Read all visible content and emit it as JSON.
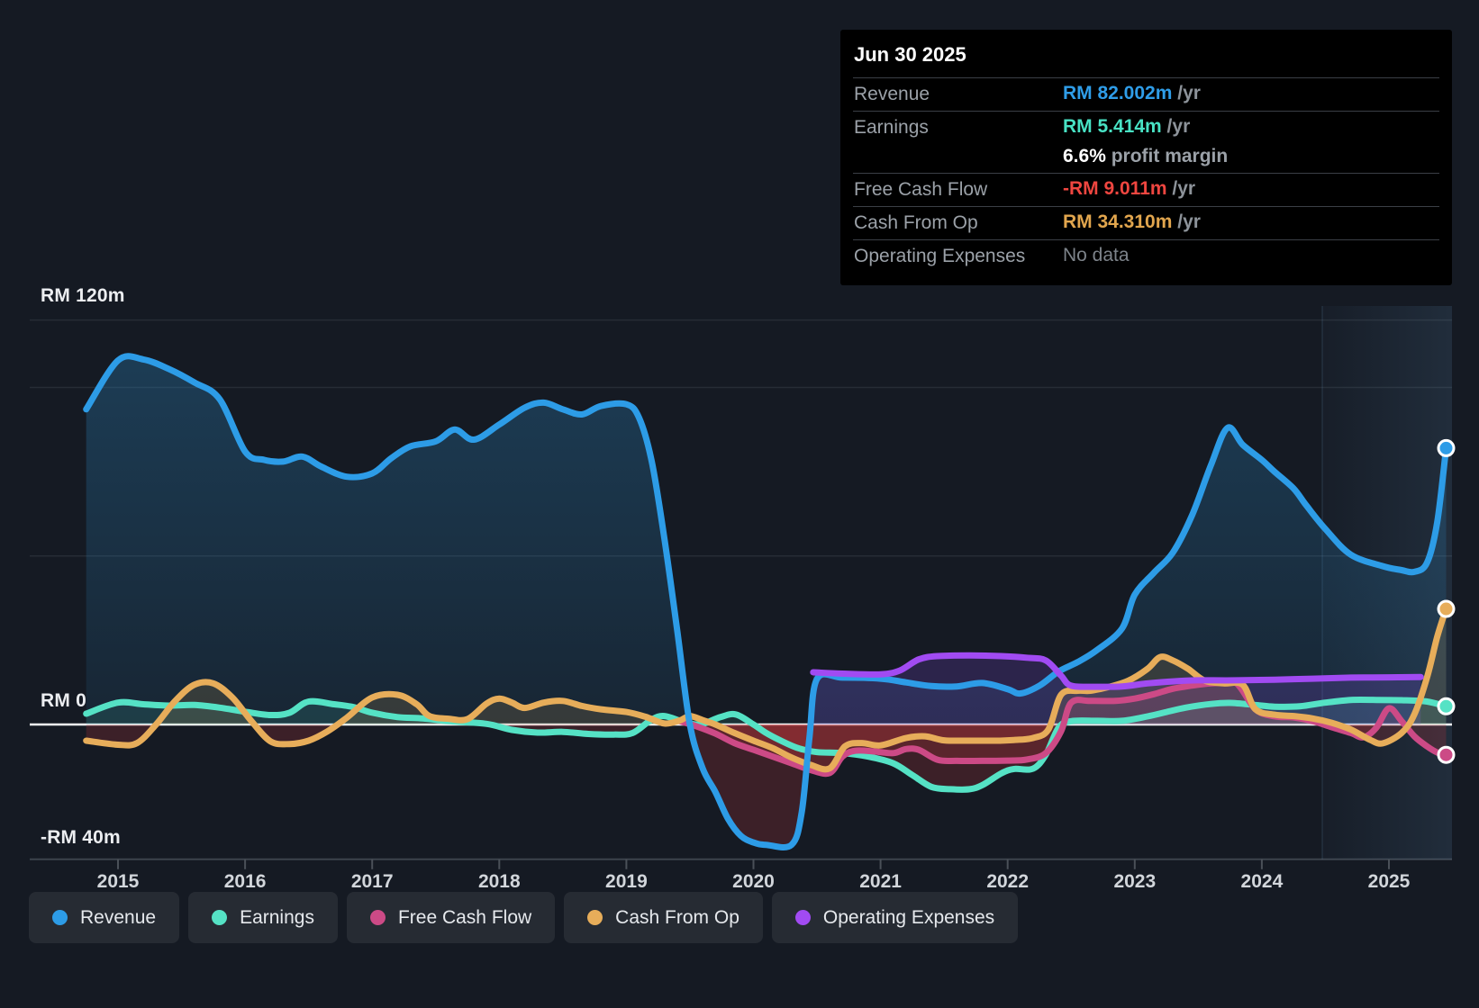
{
  "tooltip": {
    "date": "Jun 30 2025",
    "rows": [
      {
        "label": "Revenue",
        "value": "RM 82.002m",
        "suffix": " /yr",
        "color": "#2f9de8"
      },
      {
        "label": "Earnings",
        "value": "RM 5.414m",
        "suffix": " /yr",
        "color": "#48e2c4",
        "extra_value": "6.6%",
        "extra_text": " profit margin"
      },
      {
        "label": "Free Cash Flow",
        "value": "-RM 9.011m",
        "suffix": " /yr",
        "color": "#ef4640"
      },
      {
        "label": "Cash From Op",
        "value": "RM 34.310m",
        "suffix": " /yr",
        "color": "#e2a64e"
      },
      {
        "label": "Operating Expenses",
        "value": "No data",
        "suffix": "",
        "color": "#7d838a"
      }
    ]
  },
  "y_axis": {
    "labels": [
      {
        "text": "RM 120m",
        "value": 120
      },
      {
        "text": "RM 0",
        "value": 0
      },
      {
        "text": "-RM 40m",
        "value": -40
      }
    ]
  },
  "x_axis": {
    "years": [
      "2015",
      "2016",
      "2017",
      "2018",
      "2019",
      "2020",
      "2021",
      "2022",
      "2023",
      "2024",
      "2025"
    ]
  },
  "legend": [
    {
      "label": "Revenue",
      "color": "#2d9ce7"
    },
    {
      "label": "Earnings",
      "color": "#55e2c5"
    },
    {
      "label": "Free Cash Flow",
      "color": "#cc4a86"
    },
    {
      "label": "Cash From Op",
      "color": "#e7ad5a"
    },
    {
      "label": "Operating Expenses",
      "color": "#a14bf2"
    }
  ],
  "chart_data": {
    "type": "line",
    "unit": "RM millions per year",
    "x_range": [
      2014.75,
      2025.45
    ],
    "ylim": [
      -40,
      120
    ],
    "gridline_values": [
      120,
      100,
      50
    ],
    "zero_line": 0,
    "bottom_axis_value": -40,
    "legend_position": "bottom-left",
    "highlight_band_start_year": 2024.48,
    "marker_date": "Jun 30 2025",
    "series": [
      {
        "name": "Revenue",
        "color": "#2d9ce7",
        "end_dot": true,
        "points": [
          [
            2014.75,
            93.5
          ],
          [
            2015.0,
            108
          ],
          [
            2015.2,
            108.3
          ],
          [
            2015.4,
            105.5
          ],
          [
            2015.6,
            101.5
          ],
          [
            2015.8,
            96.5
          ],
          [
            2016.0,
            81
          ],
          [
            2016.15,
            78.5
          ],
          [
            2016.3,
            78
          ],
          [
            2016.45,
            79.5
          ],
          [
            2016.6,
            76.5
          ],
          [
            2016.8,
            73.5
          ],
          [
            2017.0,
            74.5
          ],
          [
            2017.15,
            79
          ],
          [
            2017.3,
            82.5
          ],
          [
            2017.5,
            84
          ],
          [
            2017.65,
            87.5
          ],
          [
            2017.8,
            84.5
          ],
          [
            2018.0,
            89
          ],
          [
            2018.2,
            94
          ],
          [
            2018.35,
            95.5
          ],
          [
            2018.5,
            93.5
          ],
          [
            2018.65,
            92
          ],
          [
            2018.8,
            94.5
          ],
          [
            2019.0,
            95
          ],
          [
            2019.1,
            91
          ],
          [
            2019.2,
            78
          ],
          [
            2019.3,
            55
          ],
          [
            2019.4,
            28
          ],
          [
            2019.5,
            0
          ],
          [
            2019.6,
            -13
          ],
          [
            2019.7,
            -20
          ],
          [
            2019.8,
            -28
          ],
          [
            2019.9,
            -33
          ],
          [
            2020.0,
            -35
          ],
          [
            2020.1,
            -35.7
          ],
          [
            2020.3,
            -35.7
          ],
          [
            2020.38,
            -26
          ],
          [
            2020.44,
            -4
          ],
          [
            2020.5,
            13.5
          ],
          [
            2020.7,
            13.9
          ],
          [
            2021.0,
            13.6
          ],
          [
            2021.2,
            12.5
          ],
          [
            2021.4,
            11.4
          ],
          [
            2021.6,
            11.3
          ],
          [
            2021.8,
            12.3
          ],
          [
            2022.0,
            10.5
          ],
          [
            2022.1,
            9.2
          ],
          [
            2022.25,
            11.5
          ],
          [
            2022.4,
            15.7
          ],
          [
            2022.55,
            18.5
          ],
          [
            2022.7,
            22
          ],
          [
            2022.9,
            28.5
          ],
          [
            2023.0,
            38.5
          ],
          [
            2023.15,
            45
          ],
          [
            2023.3,
            51
          ],
          [
            2023.45,
            62
          ],
          [
            2023.6,
            77
          ],
          [
            2023.73,
            88
          ],
          [
            2023.85,
            83
          ],
          [
            2024.0,
            78.5
          ],
          [
            2024.1,
            75
          ],
          [
            2024.25,
            70
          ],
          [
            2024.35,
            65
          ],
          [
            2024.5,
            58
          ],
          [
            2024.7,
            50.4
          ],
          [
            2024.95,
            47
          ],
          [
            2025.1,
            45.8
          ],
          [
            2025.2,
            45.3
          ],
          [
            2025.3,
            48
          ],
          [
            2025.38,
            60
          ],
          [
            2025.45,
            82
          ]
        ]
      },
      {
        "name": "Earnings",
        "color": "#55e2c5",
        "end_dot": true,
        "points": [
          [
            2014.75,
            3.2
          ],
          [
            2015.0,
            6.5
          ],
          [
            2015.2,
            6
          ],
          [
            2015.4,
            5.6
          ],
          [
            2015.6,
            5.8
          ],
          [
            2015.8,
            5
          ],
          [
            2016.0,
            3.8
          ],
          [
            2016.2,
            2.8
          ],
          [
            2016.35,
            3.5
          ],
          [
            2016.5,
            6.8
          ],
          [
            2016.7,
            6
          ],
          [
            2016.85,
            5.2
          ],
          [
            2017.0,
            3.5
          ],
          [
            2017.2,
            2.2
          ],
          [
            2017.4,
            1.8
          ],
          [
            2017.6,
            1
          ],
          [
            2017.9,
            0.2
          ],
          [
            2018.1,
            -1.6
          ],
          [
            2018.3,
            -2.4
          ],
          [
            2018.5,
            -2.2
          ],
          [
            2018.7,
            -2.8
          ],
          [
            2018.9,
            -3
          ],
          [
            2019.05,
            -2.5
          ],
          [
            2019.2,
            1.5
          ],
          [
            2019.3,
            2.5
          ],
          [
            2019.45,
            0.8
          ],
          [
            2019.58,
            0
          ],
          [
            2019.74,
            2.2
          ],
          [
            2019.86,
            3
          ],
          [
            2020.0,
            0
          ],
          [
            2020.1,
            -2.5
          ],
          [
            2020.2,
            -4.5
          ],
          [
            2020.35,
            -7
          ],
          [
            2020.5,
            -8.2
          ],
          [
            2020.7,
            -8.5
          ],
          [
            2020.9,
            -9.5
          ],
          [
            2021.1,
            -11.5
          ],
          [
            2021.25,
            -15
          ],
          [
            2021.4,
            -18.5
          ],
          [
            2021.55,
            -19.2
          ],
          [
            2021.7,
            -19.2
          ],
          [
            2021.8,
            -18
          ],
          [
            2021.95,
            -14.5
          ],
          [
            2022.05,
            -13.2
          ],
          [
            2022.2,
            -13.1
          ],
          [
            2022.3,
            -9
          ],
          [
            2022.4,
            -1
          ],
          [
            2022.5,
            1
          ],
          [
            2022.7,
            1.1
          ],
          [
            2022.9,
            1.1
          ],
          [
            2023.1,
            2.4
          ],
          [
            2023.25,
            3.7
          ],
          [
            2023.4,
            5
          ],
          [
            2023.6,
            6.1
          ],
          [
            2023.75,
            6.4
          ],
          [
            2023.95,
            5.8
          ],
          [
            2024.1,
            5.3
          ],
          [
            2024.3,
            5.4
          ],
          [
            2024.5,
            6.5
          ],
          [
            2024.7,
            7.3
          ],
          [
            2024.9,
            7.3
          ],
          [
            2025.1,
            7.2
          ],
          [
            2025.3,
            6.8
          ],
          [
            2025.45,
            5.4
          ]
        ]
      },
      {
        "name": "Free Cash Flow",
        "color": "#cc4a86",
        "end_dot": true,
        "points": [
          [
            2019.42,
            1
          ],
          [
            2019.55,
            -0.5
          ],
          [
            2019.7,
            -2.7
          ],
          [
            2019.85,
            -5.5
          ],
          [
            2020.0,
            -7.5
          ],
          [
            2020.15,
            -9.5
          ],
          [
            2020.3,
            -11.5
          ],
          [
            2020.45,
            -13.5
          ],
          [
            2020.6,
            -14.4
          ],
          [
            2020.7,
            -9.5
          ],
          [
            2020.8,
            -7.8
          ],
          [
            2020.95,
            -8
          ],
          [
            2021.1,
            -8.5
          ],
          [
            2021.2,
            -7.3
          ],
          [
            2021.3,
            -7.5
          ],
          [
            2021.45,
            -10.5
          ],
          [
            2021.6,
            -10.8
          ],
          [
            2021.8,
            -10.8
          ],
          [
            2022.0,
            -10.7
          ],
          [
            2022.15,
            -10.4
          ],
          [
            2022.3,
            -8.5
          ],
          [
            2022.42,
            -2
          ],
          [
            2022.5,
            6.5
          ],
          [
            2022.65,
            7
          ],
          [
            2022.85,
            7
          ],
          [
            2023.0,
            7.7
          ],
          [
            2023.15,
            9
          ],
          [
            2023.3,
            10.6
          ],
          [
            2023.5,
            11.8
          ],
          [
            2023.65,
            12.3
          ],
          [
            2023.8,
            12.2
          ],
          [
            2023.95,
            4.5
          ],
          [
            2024.1,
            2.4
          ],
          [
            2024.25,
            2.1
          ],
          [
            2024.4,
            1
          ],
          [
            2024.55,
            -0.8
          ],
          [
            2024.7,
            -2.5
          ],
          [
            2024.8,
            -3.8
          ],
          [
            2024.9,
            -1
          ],
          [
            2025.0,
            4.8
          ],
          [
            2025.1,
            1
          ],
          [
            2025.2,
            -3.5
          ],
          [
            2025.3,
            -6.5
          ],
          [
            2025.38,
            -8.3
          ],
          [
            2025.45,
            -9
          ]
        ]
      },
      {
        "name": "Cash From Op",
        "color": "#e7ad5a",
        "end_dot": true,
        "points": [
          [
            2014.75,
            -4.8
          ],
          [
            2015.0,
            -6
          ],
          [
            2015.15,
            -5.5
          ],
          [
            2015.3,
            0
          ],
          [
            2015.45,
            7
          ],
          [
            2015.6,
            11.8
          ],
          [
            2015.75,
            12.2
          ],
          [
            2015.9,
            8
          ],
          [
            2016.05,
            1
          ],
          [
            2016.2,
            -5
          ],
          [
            2016.35,
            -5.8
          ],
          [
            2016.5,
            -4.8
          ],
          [
            2016.65,
            -2
          ],
          [
            2016.8,
            2
          ],
          [
            2017.0,
            8
          ],
          [
            2017.2,
            8.8
          ],
          [
            2017.35,
            6
          ],
          [
            2017.45,
            2.5
          ],
          [
            2017.6,
            1.7
          ],
          [
            2017.75,
            1.6
          ],
          [
            2017.9,
            6.2
          ],
          [
            2018.0,
            7.7
          ],
          [
            2018.1,
            6.5
          ],
          [
            2018.2,
            4.9
          ],
          [
            2018.35,
            6.5
          ],
          [
            2018.5,
            7
          ],
          [
            2018.65,
            5.5
          ],
          [
            2018.8,
            4.5
          ],
          [
            2019.0,
            3.7
          ],
          [
            2019.15,
            2.3
          ],
          [
            2019.3,
            0.3
          ],
          [
            2019.42,
            1.2
          ],
          [
            2019.5,
            2.5
          ],
          [
            2019.6,
            1.3
          ],
          [
            2019.7,
            0
          ],
          [
            2019.85,
            -2.5
          ],
          [
            2020.0,
            -4.8
          ],
          [
            2020.15,
            -7
          ],
          [
            2020.3,
            -9.8
          ],
          [
            2020.45,
            -12
          ],
          [
            2020.6,
            -13
          ],
          [
            2020.72,
            -6.5
          ],
          [
            2020.85,
            -5.5
          ],
          [
            2021.0,
            -6.2
          ],
          [
            2021.2,
            -4
          ],
          [
            2021.35,
            -3.5
          ],
          [
            2021.5,
            -4.7
          ],
          [
            2021.7,
            -4.8
          ],
          [
            2021.9,
            -4.8
          ],
          [
            2022.05,
            -4.6
          ],
          [
            2022.2,
            -4
          ],
          [
            2022.32,
            -1.5
          ],
          [
            2022.42,
            8.8
          ],
          [
            2022.55,
            10
          ],
          [
            2022.65,
            10
          ],
          [
            2022.8,
            11.2
          ],
          [
            2022.95,
            13
          ],
          [
            2023.1,
            16.5
          ],
          [
            2023.2,
            20
          ],
          [
            2023.3,
            19
          ],
          [
            2023.42,
            16.5
          ],
          [
            2023.55,
            13
          ],
          [
            2023.7,
            12.2
          ],
          [
            2023.85,
            11.8
          ],
          [
            2023.95,
            4.5
          ],
          [
            2024.1,
            2.9
          ],
          [
            2024.25,
            2.5
          ],
          [
            2024.4,
            1.8
          ],
          [
            2024.55,
            0.5
          ],
          [
            2024.7,
            -1.5
          ],
          [
            2024.85,
            -4.5
          ],
          [
            2024.95,
            -5.6
          ],
          [
            2025.1,
            -2.5
          ],
          [
            2025.2,
            3
          ],
          [
            2025.3,
            14
          ],
          [
            2025.38,
            26
          ],
          [
            2025.45,
            34.3
          ]
        ]
      },
      {
        "name": "Operating Expenses",
        "color": "#a14bf2",
        "end_dot": false,
        "points": [
          [
            2020.47,
            15.5
          ],
          [
            2020.7,
            15.1
          ],
          [
            2021.0,
            14.9
          ],
          [
            2021.15,
            16
          ],
          [
            2021.3,
            19.3
          ],
          [
            2021.45,
            20.3
          ],
          [
            2021.7,
            20.5
          ],
          [
            2021.95,
            20.3
          ],
          [
            2022.15,
            19.8
          ],
          [
            2022.3,
            19
          ],
          [
            2022.42,
            14.5
          ],
          [
            2022.5,
            11.5
          ],
          [
            2022.7,
            11.2
          ],
          [
            2022.9,
            11.3
          ],
          [
            2023.1,
            12.2
          ],
          [
            2023.3,
            12.8
          ],
          [
            2023.5,
            13.1
          ],
          [
            2023.8,
            13.1
          ],
          [
            2024.1,
            13.3
          ],
          [
            2024.4,
            13.6
          ],
          [
            2024.7,
            13.9
          ],
          [
            2025.0,
            14
          ],
          [
            2025.25,
            14.1
          ]
        ]
      }
    ]
  }
}
